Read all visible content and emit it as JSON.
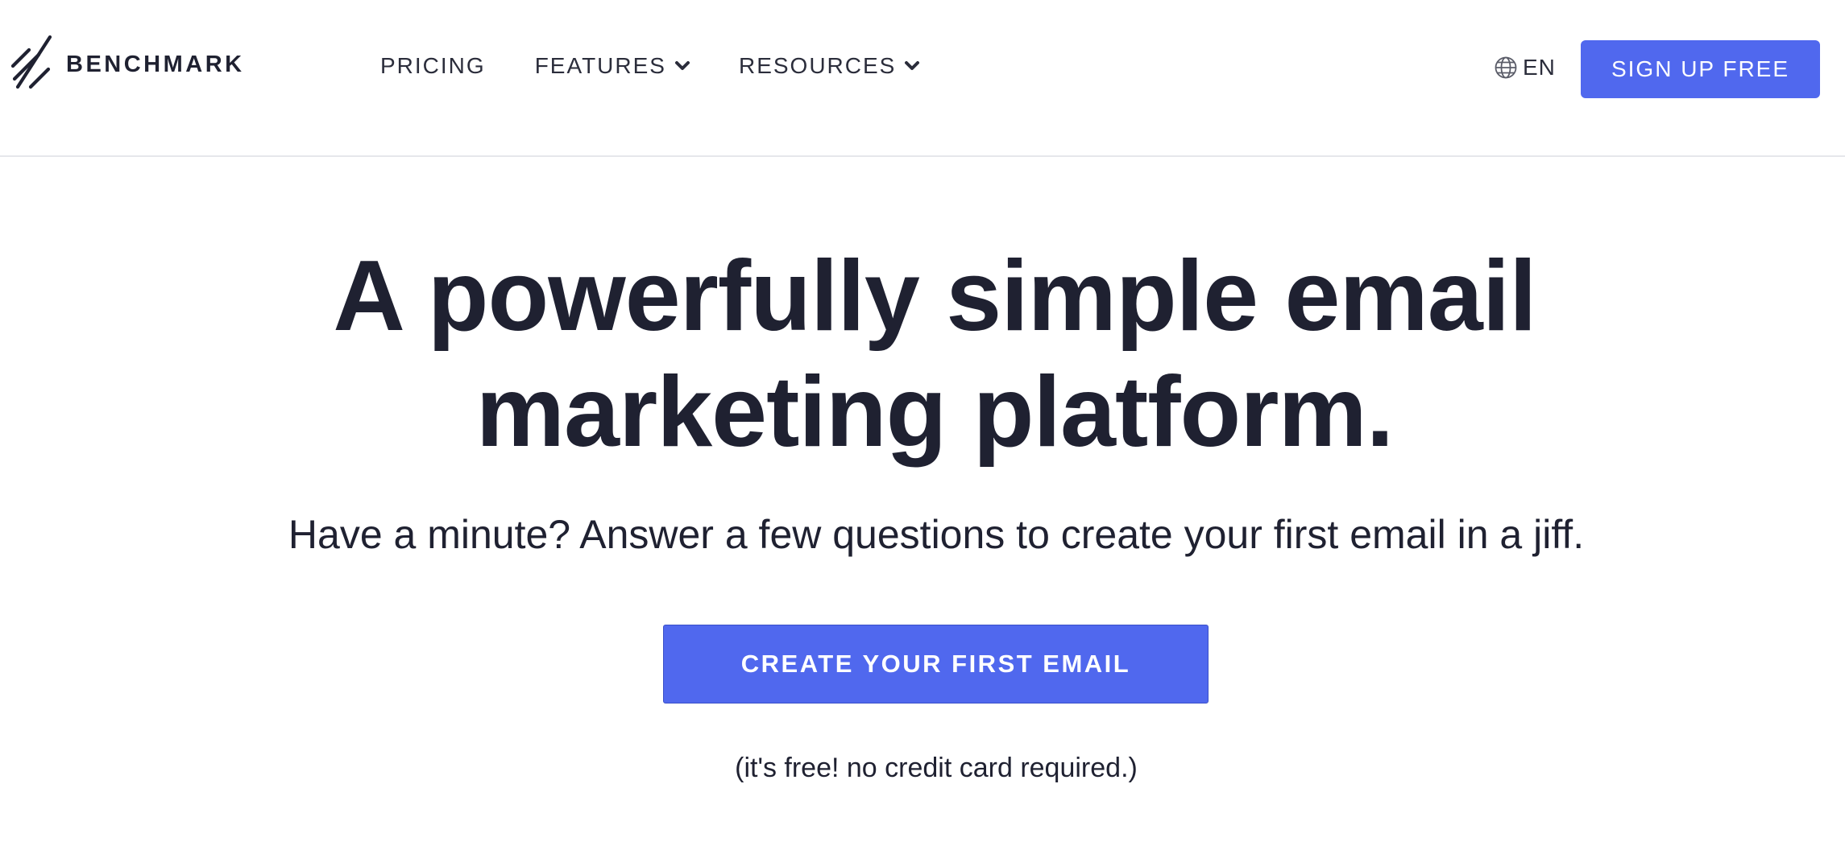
{
  "brand": {
    "name": "BENCHMARK",
    "logo_icon": "benchmark-stripes-logo",
    "text_color": "#1f2131"
  },
  "nav": {
    "items": [
      {
        "label": "PRICING",
        "has_dropdown": false
      },
      {
        "label": "FEATURES",
        "has_dropdown": true,
        "icon": "chevron-down-icon"
      },
      {
        "label": "RESOURCES",
        "has_dropdown": true,
        "icon": "chevron-down-icon"
      }
    ]
  },
  "language": {
    "icon": "globe-icon",
    "label": "EN"
  },
  "header": {
    "signup_label": "SIGN UP FREE"
  },
  "hero": {
    "title_line_1": "A powerfully simple email",
    "title_line_2": "marketing platform.",
    "subtitle": "Have a minute? Answer a few questions to create your first email in a jiff.",
    "cta_label": "CREATE YOUR FIRST EMAIL",
    "note": "(it's free! no credit card required.)"
  },
  "colors": {
    "accent": "#5068ee",
    "text": "#1f2131",
    "divider": "#e6e7eb",
    "background": "#ffffff"
  }
}
